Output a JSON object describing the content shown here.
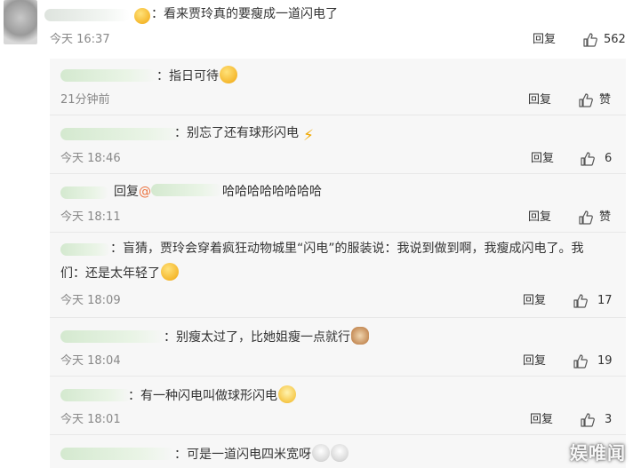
{
  "main_comment": {
    "text": "：看来贾玲真的要瘦成一道闪电了",
    "time": "今天 16:37",
    "reply_label": "回复",
    "likes": "562"
  },
  "replies": [
    {
      "text": "：指日可待",
      "emoji": "face",
      "time": "21分钟前",
      "reply_label": "回复",
      "likes": "赞"
    },
    {
      "text": "：别忘了还有球形闪电",
      "emoji": "bolt",
      "time": "今天 18:46",
      "reply_label": "回复",
      "likes": "6"
    },
    {
      "text_prefix": "回复",
      "mention": "@",
      "text": "哈哈哈哈哈哈哈哈",
      "time": "今天 18:11",
      "reply_label": "回复",
      "likes": "赞"
    },
    {
      "text": "：盲猜，贾玲会穿着疯狂动物城里“闪电”的服装说：我说到做到啊，我瘦成闪电了。我",
      "text_line2": "们：还是太年轻了",
      "emoji": "cry",
      "time": "今天 18:09",
      "reply_label": "回复",
      "likes": "17"
    },
    {
      "text": "：别瘦太过了，比她姐瘦一点就行",
      "emoji": "cat",
      "time": "今天 18:04",
      "reply_label": "回复",
      "likes": "19"
    },
    {
      "text": "：有一种闪电叫做球形闪电",
      "emoji": "mask-face",
      "time": "今天 18:01",
      "reply_label": "回复",
      "likes": "3"
    },
    {
      "text": "：可是一道闪电四米宽呀",
      "emoji": "bun"
    }
  ],
  "icons": {
    "like": "thumbs-up-icon",
    "lightning": "lightning-icon"
  },
  "watermark": "娱唯闻",
  "colors": {
    "panel_bg": "#f7f7f7",
    "meta": "#888888",
    "mention": "#eb7340",
    "text": "#333333"
  }
}
